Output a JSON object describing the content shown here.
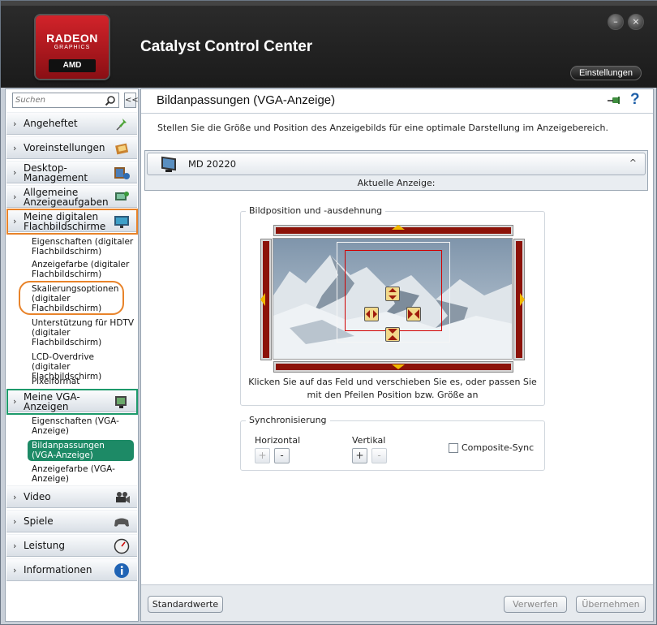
{
  "window": {
    "app_title": "Catalyst Control Center",
    "settings_label": "Einstellungen",
    "logo": {
      "line1": "RADEON",
      "line2": "GRAPHICS",
      "line3": "AMD"
    }
  },
  "sidebar": {
    "search_placeholder": "Suchen",
    "collapse_label": "<<",
    "categories": [
      {
        "label": "Angeheftet",
        "icon": "pin-icon"
      },
      {
        "label": "Voreinstellungen",
        "icon": "presets-icon"
      },
      {
        "label": "Desktop-Management",
        "icon": "desktop-icon"
      },
      {
        "label": "Allgemeine Anzeigeaufgaben",
        "icon": "display-tasks-icon"
      },
      {
        "label": "Meine digitalen Flachbildschirme",
        "icon": "flat-panel-icon"
      },
      {
        "label": "Meine VGA-Anzeigen",
        "icon": "vga-monitor-icon"
      },
      {
        "label": "Video",
        "icon": "video-camera-icon"
      },
      {
        "label": "Spiele",
        "icon": "gamepad-icon"
      },
      {
        "label": "Leistung",
        "icon": "gauge-icon"
      },
      {
        "label": "Informationen",
        "icon": "info-icon"
      }
    ],
    "digital_items": [
      "Eigenschaften (digitaler Flachbildschirm)",
      "Anzeigefarbe (digitaler Flachbildschirm)",
      "Skalierungsoptionen (digitaler Flachbildschirm)",
      "Unterstützung für HDTV (digitaler Flachbildschirm)",
      "LCD-Overdrive (digitaler Flachbildschirm)",
      "Pixelformat"
    ],
    "vga_items": [
      "Eigenschaften (VGA-Anzeige)",
      "Bildanpassungen (VGA-Anzeige)",
      "Anzeigefarbe (VGA-Anzeige)"
    ]
  },
  "main": {
    "title": "Bildanpassungen (VGA-Anzeige)",
    "help": "?",
    "description": "Stellen Sie die Größe und Position des Anzeigebilds für eine optimale Darstellung im Anzeigebereich.",
    "display": {
      "name": "MD 20220",
      "sub_label": "Aktuelle Anzeige:"
    },
    "position_group": {
      "label": "Bildposition und -ausdehnung",
      "hint_line1": "Klicken Sie auf das Feld und verschieben Sie es, oder passen Sie",
      "hint_line2": "mit den Pfeilen Position bzw. Größe an"
    },
    "sync_group": {
      "label": "Synchronisierung",
      "horizontal": "Horizontal",
      "vertical": "Vertikal",
      "plus": "+",
      "minus": "-",
      "composite_sync": "Composite-Sync",
      "composite_sync_checked": false
    },
    "footer": {
      "defaults": "Standardwerte",
      "discard": "Verwerfen",
      "apply": "Übernehmen"
    }
  },
  "colors": {
    "accent_green": "#1d8a66",
    "highlight_orange": "#e8832a",
    "bar_red": "#8c1208"
  }
}
